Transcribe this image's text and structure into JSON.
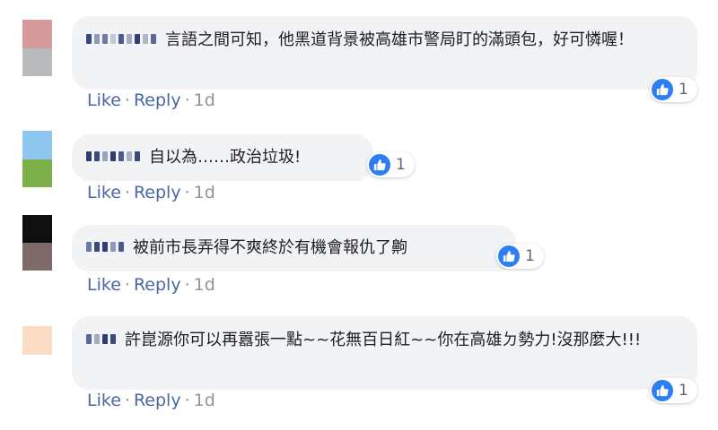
{
  "labels": {
    "like": "Like",
    "reply": "Reply",
    "sep": "·"
  },
  "comments": [
    {
      "avatar_colors": [
        "#d59a99",
        "#b9babe"
      ],
      "name_blocks": [
        "#3a4a80",
        "#8f9ab8",
        "#6f7ba3",
        "#c2c7d6",
        "#4b5b8e",
        "#a3abc4",
        "#2f3f75",
        "#b0b6ca",
        "#5a6895"
      ],
      "text": "言語之間可知，他黑道背景被高雄市警局盯的滿頭包，好可憐喔！",
      "reactions": "1",
      "time": "1d"
    },
    {
      "avatar_colors": [
        "#8ec6ef",
        "#7db04a"
      ],
      "name_blocks": [
        "#2d3c72",
        "#3a4a80",
        "#9aa3c0",
        "#2f3f75",
        "#4b5b8e",
        "#aab2c9",
        "#3a4a80"
      ],
      "text": "自以為……政治垃圾!",
      "reactions": "1",
      "time": "1d"
    },
    {
      "avatar_colors": [
        "#0f0f10",
        "#7e6a68"
      ],
      "name_blocks": [
        "#6a78a5",
        "#3a4a80",
        "#2f3f75",
        "#8f9ab8",
        "#4b5b8e"
      ],
      "text": "被前市長弄得不爽終於有機會報仇了齁",
      "reactions": "1",
      "time": "1d"
    },
    {
      "avatar_colors": [
        "#fbdcc4",
        "#fbdcc4"
      ],
      "name_blocks": [
        "#5a6895",
        "#a3abc4",
        "#2f3f75",
        "#3a4a80"
      ],
      "text": "許崑源你可以再囂張一點~~花無百日紅~~你在高雄ㄉ勢力!沒那麼大!!!",
      "reactions": "1",
      "time": "1d"
    }
  ]
}
